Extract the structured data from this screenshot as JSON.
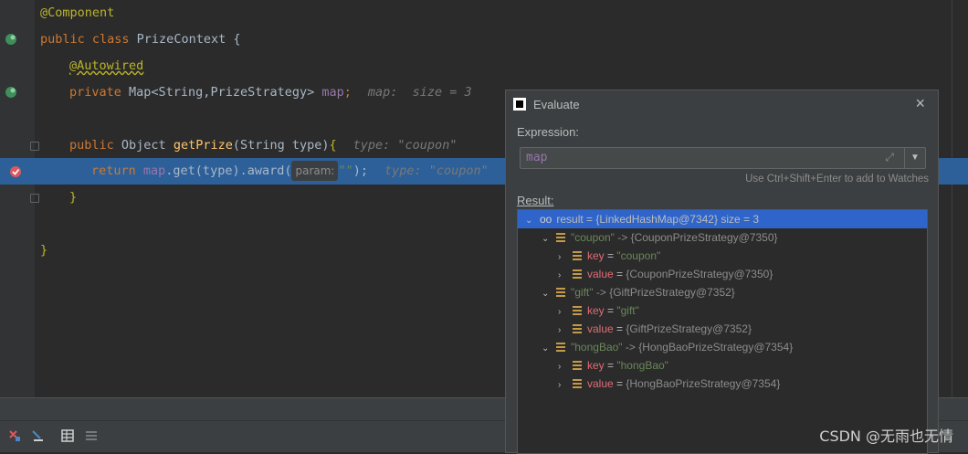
{
  "code": {
    "line1": "@Component",
    "line2_kw": "public class",
    "line2_name": " PrizeContext {",
    "line3": "@Autowired",
    "line4_kw": "private",
    "line4_type": " Map<String,PrizeStrategy> ",
    "line4_field": "map",
    "line4_semi": ";",
    "line4_hint": "map:  size = 3",
    "line5_kw": "public",
    "line5_type": " Object ",
    "line5_fn": "getPrize",
    "line5_args": "(String type)",
    "line5_brace": "{",
    "line5_hint": "type: \"coupon\"",
    "line6_kw": "return",
    "line6_field": " map",
    "line6_call": ".get(type).award(",
    "line6_param": "param:",
    "line6_str": "\"\"",
    "line6_end": ");",
    "line6_hint": "type: \"coupon\"",
    "line7": "}",
    "line8": "}"
  },
  "dialog": {
    "title": "Evaluate",
    "close": "×",
    "expression_label": "Expression:",
    "expression_value": "map",
    "watches_hint": "Use Ctrl+Shift+Enter to add to Watches",
    "result_label": "Result:",
    "tree": {
      "root": "result = {LinkedHashMap@7342}  size = 3",
      "entries": [
        {
          "label_str": "\"coupon\"",
          "label_rest": " -> {CouponPrizeStrategy@7350}",
          "key": "\"coupon\"",
          "value": "{CouponPrizeStrategy@7350}"
        },
        {
          "label_str": "\"gift\"",
          "label_rest": " -> {GiftPrizeStrategy@7352}",
          "key": "\"gift\"",
          "value": "{GiftPrizeStrategy@7352}"
        },
        {
          "label_str": "\"hongBao\"",
          "label_rest": " -> {HongBaoPrizeStrategy@7354}",
          "key": "\"hongBao\"",
          "value": "{HongBaoPrizeStrategy@7354}"
        }
      ],
      "key_name": "key",
      "value_name": "value",
      "eq": " = "
    }
  },
  "watermark": "CSDN @无雨也无情",
  "colors": {
    "accent": "#2d6099",
    "selection": "#2f65ca"
  }
}
